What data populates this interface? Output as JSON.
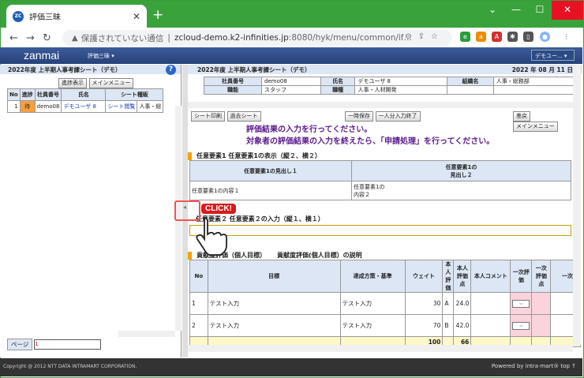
{
  "browser": {
    "tab_title": "評価三昧",
    "favicon_text": "ZC",
    "url_security": "保護されていない通信",
    "url_host": "zcloud-demo.k2-infinities.jp",
    "url_path": ":8080/hyk/menu/common/if…"
  },
  "app": {
    "logo": "zanmai",
    "menu_label": "評価三昧 ▾",
    "user_label": "デモユー... ▾",
    "footer_copyright": "Copyright @ 2012 NTT DATA INTRAMART CORPORATION.",
    "footer_powered": "Powered by intra-mart®   top ↑"
  },
  "left": {
    "title": "2022年度 上半期人事考課シート（デモ）",
    "btn_progress": "進捗表示",
    "btn_main": "メインメニュー",
    "columns": [
      "No",
      "進捗",
      "社員番号",
      "氏名",
      "シート種販"
    ],
    "rows": [
      {
        "no": "1",
        "status": "待",
        "emp": "demo08",
        "name": "デモユーザ 8",
        "sheet": "シート閲覧",
        "extra": "人事・総"
      }
    ],
    "page_label": "ページ",
    "page_value": "1"
  },
  "right": {
    "title": "2022年度 上半期人事考課シート（デモ）",
    "date": "2022 年 08 月 11 日",
    "info": {
      "emp_no_label": "社員番号",
      "emp_no": "demo08",
      "name_label": "氏名",
      "name": "デモユーザ 8",
      "org_label": "組織名",
      "org": "人事・総務部",
      "job_label": "職能",
      "job": "スタッフ",
      "rank_label": "職種",
      "rank": "人事・人材開発"
    },
    "btn_print": "シート印刷",
    "btn_past": "過去シート",
    "btn_save": "一時保存",
    "btn_done": "一人分入力終了",
    "btn_reject": "差戻",
    "btn_main": "メインメニュー",
    "msg1": "評価結果の入力を行ってください。",
    "msg2": "対象者の評価結果の入力を終えたら、「申請処理」を行ってください。",
    "sec1": "任意要素1 任意要素1の表示（縦２、横２）",
    "t1_h1": "任意要素1の見出し１",
    "t1_h2a": "任意要素1の",
    "t1_h2b": "見出し２",
    "t1_c1": "任意要素1の内容１",
    "t1_c2a": "任意要素1の",
    "t1_c2b": "内容２",
    "sec2": "任意要素２ 任意要素２の入力（縦１、横１）",
    "sec3a": "貢献度評価（個人目標）",
    "sec3b": "貢献度評価(個人目標）の説明",
    "t3_cols": [
      "No",
      "目標",
      "達成方策・基準",
      "ウェイト",
      "本人評価",
      "本人評価点",
      "本人コメント",
      "一次評価",
      "一次評価点",
      "一次コ"
    ],
    "t3_rows": [
      {
        "no": "1",
        "goal": "テスト入力",
        "method": "テスト入力",
        "weight": "30",
        "grade": "A",
        "score": "24.0"
      },
      {
        "no": "2",
        "goal": "テスト入力",
        "method": "テスト入力",
        "weight": "70",
        "grade": "B",
        "score": "42.0"
      }
    ],
    "t3_sum_weight": "100",
    "t3_sum_score": "66"
  },
  "overlay": {
    "click_label": "CLICK!"
  }
}
